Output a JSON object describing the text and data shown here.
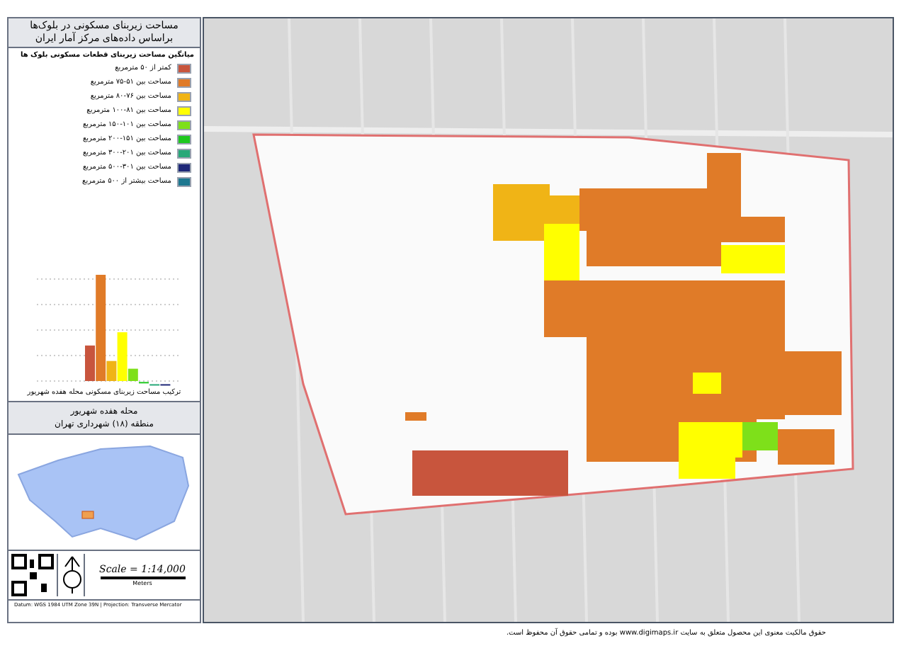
{
  "legend": {
    "title": "مساحت زیربنای مسکونی در بلوک‌ها",
    "subtitle": "براساس داده‌های مرکز آمار ایران",
    "heading": "میانگین مساحت زیربنای قطعات مسکونی بلوک ها",
    "items": [
      {
        "label": "کمتر از ۵۰ مترمربع",
        "color": "#c8553d"
      },
      {
        "label": "مساحت بین ۵۱-۷۵ مترمربع",
        "color": "#e07b28"
      },
      {
        "label": "مساحت بین ۷۶-۸۰ مترمربع",
        "color": "#f0b416"
      },
      {
        "label": "مساحت بین ۸۱-۱۰۰ مترمربع",
        "color": "#ffff00"
      },
      {
        "label": "مساحت بین ۱۰۱-۱۵۰ مترمربع",
        "color": "#7ee01a"
      },
      {
        "label": "مساحت بین ۱۵۱-۲۰۰ مترمربع",
        "color": "#1ec81e"
      },
      {
        "label": "مساحت بین ۲۰۱-۳۰۰ مترمربع",
        "color": "#28a878"
      },
      {
        "label": "مساحت بین ۳۰۱-۵۰۰ مترمربع",
        "color": "#1e2878"
      },
      {
        "label": "مساحت بیشتر از ۵۰۰ مترمربع",
        "color": "#1e7890"
      }
    ]
  },
  "chart": {
    "caption": "ترکیب مساحت زیربنای مسکونی محله هفده شهریور"
  },
  "inset": {
    "neighborhood": "محله هفده شهریور",
    "district": "منطقه (۱۸) شهرداری تهران"
  },
  "scale": {
    "text": "Scale = 1:14,000",
    "unit": "Meters"
  },
  "projection": "Datum: WGS 1984 UTM Zone 39N | Projection: Transverse Mercator",
  "footer": "حقوق مالکیت معنوی این محصول متعلق به سایت www.digimaps.ir بوده و تمامی حقوق آن محفوظ است."
}
